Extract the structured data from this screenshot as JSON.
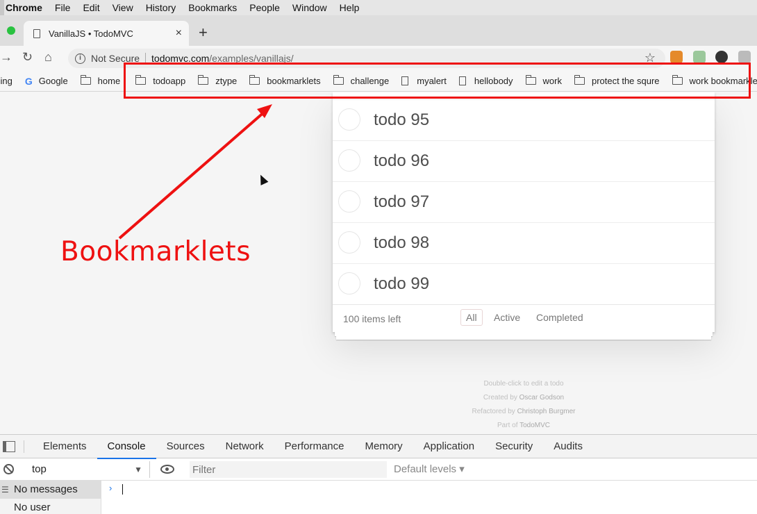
{
  "menubar": {
    "app": "Chrome",
    "items": [
      "File",
      "Edit",
      "View",
      "History",
      "Bookmarks",
      "People",
      "Window",
      "Help"
    ]
  },
  "tab": {
    "title": "VanillaJS • TodoMVC",
    "close": "×",
    "new_tab": "+"
  },
  "address": {
    "security": "Not Secure",
    "url_host": "todomvc.com",
    "url_path": "/examples/vanillajs/"
  },
  "bookmarks": {
    "items": [
      {
        "label": "sing",
        "icon": "page"
      },
      {
        "label": "Google",
        "icon": "google"
      },
      {
        "label": "home",
        "icon": "folder"
      },
      {
        "label": "todoapp",
        "icon": "folder"
      },
      {
        "label": "ztype",
        "icon": "folder"
      },
      {
        "label": "bookmarklets",
        "icon": "folder"
      },
      {
        "label": "challenge",
        "icon": "folder"
      },
      {
        "label": "myalert",
        "icon": "page"
      },
      {
        "label": "hellobody",
        "icon": "page"
      },
      {
        "label": "work",
        "icon": "folder"
      },
      {
        "label": "protect the squre",
        "icon": "folder"
      },
      {
        "label": "work bookmarklets",
        "icon": "folder"
      }
    ]
  },
  "annotation": {
    "label": "Bookmarklets",
    "color": "#ee1111"
  },
  "todos": {
    "items": [
      "todo 95",
      "todo 96",
      "todo 97",
      "todo 98",
      "todo 99"
    ],
    "count_text": "100 items left",
    "filters": [
      "All",
      "Active",
      "Completed"
    ],
    "selected_filter": "All"
  },
  "info": {
    "line1": "Double-click to edit a todo",
    "created_prefix": "Created by ",
    "created_name": "Oscar Godson",
    "refactored_prefix": "Refactored by ",
    "refactored_name": "Christoph Burgmer",
    "part_prefix": "Part of ",
    "part_name": "TodoMVC"
  },
  "devtools": {
    "tabs": [
      "Elements",
      "Console",
      "Sources",
      "Network",
      "Performance",
      "Memory",
      "Application",
      "Security",
      "Audits"
    ],
    "active_tab": "Console",
    "context": "top",
    "filter_placeholder": "Filter",
    "levels": "Default levels ▾",
    "sidebar": [
      "No messages",
      "No user messages"
    ],
    "prompt": "›"
  }
}
